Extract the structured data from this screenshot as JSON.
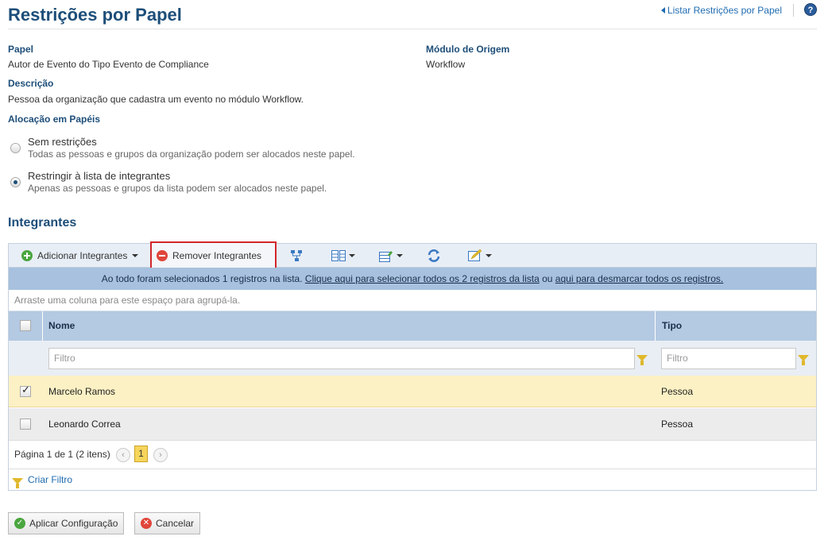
{
  "header": {
    "title": "Restrições por Papel",
    "back_link": "Listar Restrições por Papel",
    "help_glyph": "?"
  },
  "info": {
    "papel_label": "Papel",
    "papel_value": "Autor de Evento do Tipo Evento de Compliance",
    "modulo_label": "Módulo de Origem",
    "modulo_value": "Workflow",
    "descricao_label": "Descrição",
    "descricao_value": "Pessoa da organização que cadastra um evento no módulo Workflow.",
    "alocacao_label": "Alocação em Papéis"
  },
  "allocation": {
    "options": [
      {
        "title": "Sem restrições",
        "desc": "Todas as pessoas e grupos da organização podem ser alocados neste papel.",
        "selected": false
      },
      {
        "title": "Restringir à lista de integrantes",
        "desc": "Apenas as pessoas e grupos da lista podem ser alocados neste papel.",
        "selected": true
      }
    ]
  },
  "integrantes": {
    "section_title": "Integrantes",
    "toolbar": {
      "add_label": "Adicionar Integrantes",
      "remove_label": "Remover Integrantes"
    },
    "selection_bar": {
      "prefix": "Ao todo foram selecionados 1 registros na lista.",
      "select_all_link": "Clique aqui para selecionar todos os 2 registros da lista",
      "middle": "ou",
      "deselect_link": "aqui para desmarcar todos os registros."
    },
    "group_hint": "Arraste uma coluna para este espaço para agrupá-la.",
    "columns": {
      "nome": "Nome",
      "tipo": "Tipo"
    },
    "filter_placeholder": "Filtro",
    "rows": [
      {
        "nome": "Marcelo Ramos",
        "tipo": "Pessoa",
        "checked": true
      },
      {
        "nome": "Leonardo Correa",
        "tipo": "Pessoa",
        "checked": false
      }
    ],
    "pager": {
      "text": "Página 1 de 1 (2 itens)",
      "current_page": "1",
      "prev_glyph": "‹",
      "next_glyph": "›"
    },
    "create_filter_label": "Criar Filtro"
  },
  "footer": {
    "apply_label": "Aplicar Configuração",
    "cancel_label": "Cancelar",
    "apply_glyph": "✓",
    "cancel_glyph": "✕"
  },
  "colors": {
    "title": "#1d4e79",
    "link": "#1f6bb0",
    "selection_bar": "#a7c1de",
    "header_row": "#b4c9e2",
    "selected_row": "#fcf1c4",
    "highlight_border": "#d0262a"
  },
  "icons": [
    "back-arrow-icon",
    "help-icon",
    "add-icon",
    "remove-icon",
    "hierarchy-icon",
    "columns-icon",
    "export-icon",
    "refresh-icon",
    "edit-icon",
    "funnel-icon",
    "check-icon",
    "cancel-icon"
  ]
}
